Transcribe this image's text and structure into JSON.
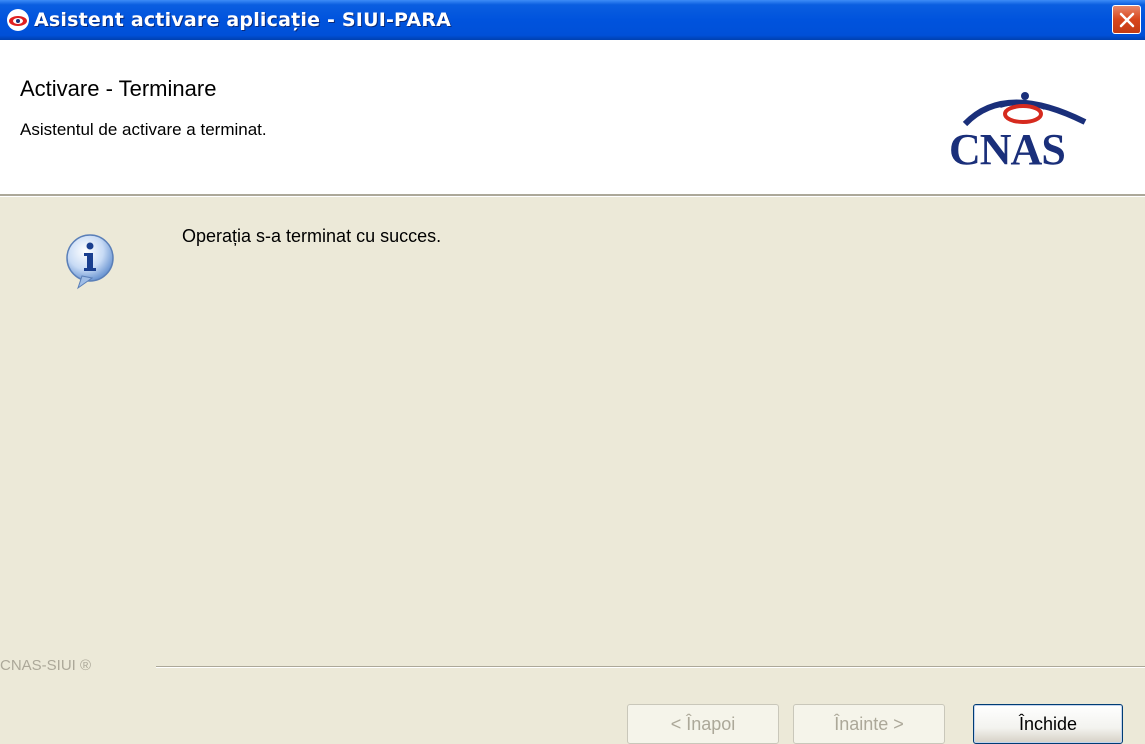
{
  "window": {
    "title": "Asistent activare aplicație - SIUI-PARA",
    "icon": "eye-app-icon",
    "close_icon": "close-x-icon"
  },
  "header": {
    "title": "Activare - Terminare",
    "subtitle": "Asistentul de activare a terminat.",
    "logo_text": "CNAS",
    "logo_icon": "cnas-logo"
  },
  "content": {
    "icon": "info-icon",
    "message": "Operația s-a terminat cu succes."
  },
  "footer": {
    "brand": "CNAS-SIUI ®",
    "buttons": {
      "back_label": "< Înapoi",
      "next_label": "Înainte >",
      "close_label": "Închide"
    }
  },
  "colors": {
    "titlebar": "#0053dd",
    "dialog_bg": "#ece9d8",
    "logo_blue": "#1a2f7a",
    "logo_red": "#d62a1e"
  }
}
